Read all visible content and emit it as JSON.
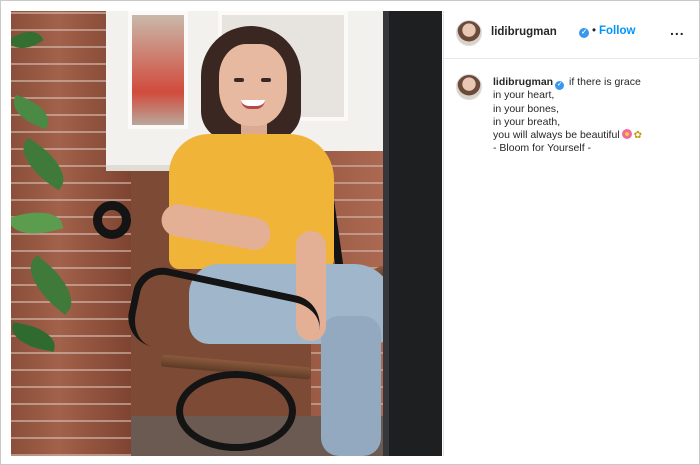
{
  "post": {
    "username": "lidibrugman",
    "verified_icon": "verified-badge-icon",
    "separator": "•",
    "follow_label": "Follow",
    "more_label": "...",
    "caption": {
      "username": "lidibrugman",
      "lines": [
        "if there is grace",
        "in your heart,",
        "in your bones,",
        "in your breath,",
        "you will always be beautiful",
        "- Bloom for Yourself -"
      ],
      "emoji_icons": [
        "flower-emoji-icon",
        "bee-emoji-icon"
      ],
      "bee_glyph": "✿"
    }
  },
  "colors": {
    "follow": "#0095f6",
    "verified": "#3897f0",
    "text": "#262626"
  }
}
